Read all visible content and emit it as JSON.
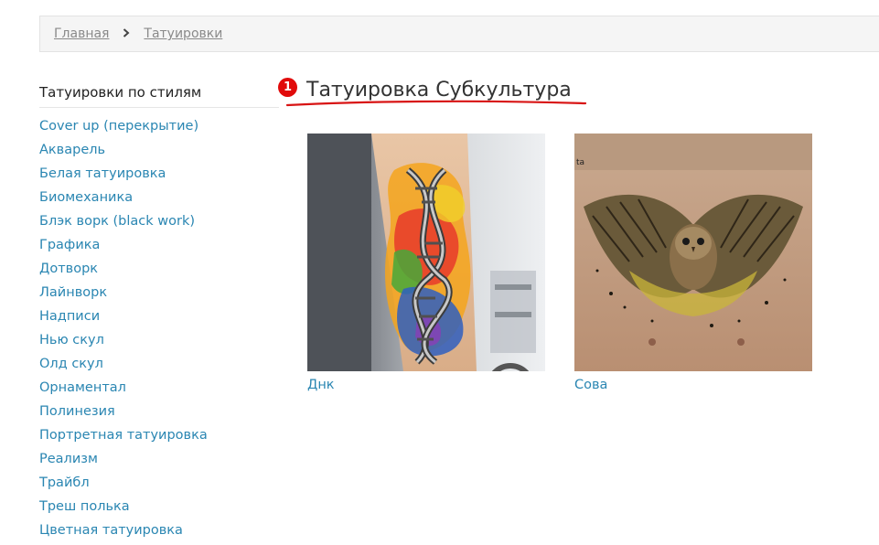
{
  "breadcrumb": {
    "home": "Главная",
    "current": "Татуировки"
  },
  "sidebar": {
    "title": "Татуировки по стилям",
    "items": [
      {
        "label": "Cover up (перекрытие)"
      },
      {
        "label": "Акварель"
      },
      {
        "label": "Белая татуировка"
      },
      {
        "label": "Биомеханика"
      },
      {
        "label": "Блэк ворк (black work)"
      },
      {
        "label": "Графика"
      },
      {
        "label": "Дотворк"
      },
      {
        "label": "Лайнворк"
      },
      {
        "label": "Надписи"
      },
      {
        "label": "Нью скул"
      },
      {
        "label": "Олд скул"
      },
      {
        "label": "Орнаментал"
      },
      {
        "label": "Полинезия"
      },
      {
        "label": "Портретная татуировка"
      },
      {
        "label": "Реализм"
      },
      {
        "label": "Трайбл"
      },
      {
        "label": "Треш полька"
      },
      {
        "label": "Цветная татуировка"
      }
    ]
  },
  "main": {
    "annotation_badge": "1",
    "title": "Татуировка Субкультура",
    "gallery": [
      {
        "caption": "Днк",
        "image": "dna-watercolor-tattoo-photo"
      },
      {
        "caption": "Сова",
        "image": "owl-chest-tattoo-photo"
      }
    ]
  },
  "colors": {
    "link": "#2a86b2",
    "annotation_red": "#e10b0b",
    "breadcrumb_bg": "#f5f5f5"
  }
}
